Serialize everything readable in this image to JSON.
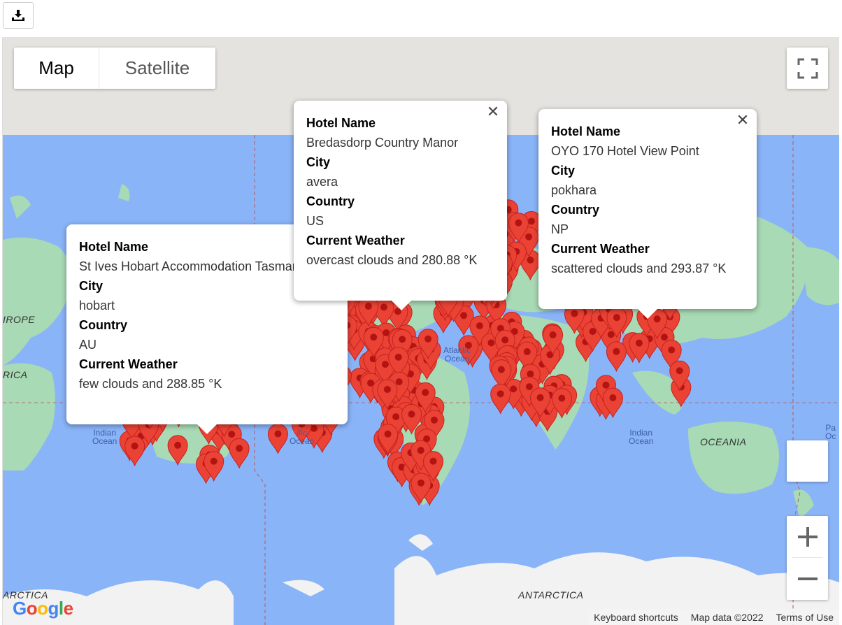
{
  "toolbar": {
    "download_icon": "download-icon"
  },
  "map_controls": {
    "map_label": "Map",
    "satellite_label": "Satellite",
    "fullscreen_icon": "fullscreen-icon",
    "zoom_in_icon": "plus-icon",
    "zoom_out_icon": "minus-icon"
  },
  "map_labels": {
    "europe": "IROPE",
    "africa": "RICA",
    "indian_ocean_1": "Indian\nOcean",
    "pacific_ocean": "ific\nOcean",
    "atlantic_ocean": "Atlantic\nOcean",
    "indian_ocean_2": "Indian\nOcean",
    "oceania": "OCEANIA",
    "pacific_right": "Pa\nOc",
    "antarctica_left": "ARCTICA",
    "antarctica": "ANTARCTICA"
  },
  "info_windows": [
    {
      "hotel_label": "Hotel Name",
      "hotel": "St Ives Hobart Accommodation Tasmania",
      "city_label": "City",
      "city": "hobart",
      "country_label": "Country",
      "country": "AU",
      "weather_label": "Current Weather",
      "weather": "few clouds and 288.85 °K"
    },
    {
      "hotel_label": "Hotel Name",
      "hotel": "Bredasdorp Country Manor",
      "city_label": "City",
      "city": "avera",
      "country_label": "Country",
      "country": "US",
      "weather_label": "Current Weather",
      "weather": "overcast clouds and 280.88 °K"
    },
    {
      "hotel_label": "Hotel Name",
      "hotel": "OYO 170 Hotel View Point",
      "city_label": "City",
      "city": "pokhara",
      "country_label": "Country",
      "country": "NP",
      "weather_label": "Current Weather",
      "weather": "scattered clouds and 293.87 °K"
    }
  ],
  "attribution": {
    "google_logo": "Google",
    "keyboard": "Keyboard shortcuts",
    "map_data": "Map data ©2022",
    "terms": "Terms of Use"
  },
  "colors": {
    "ocean": "#8ab4f8",
    "land": "#a8dab5",
    "ice": "#f2f2f2",
    "marker": "#ea4335",
    "marker_dot": "#b31412"
  }
}
